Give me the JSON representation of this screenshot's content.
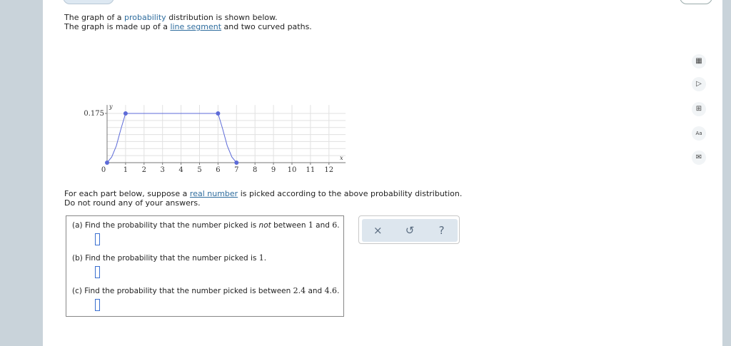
{
  "intro": {
    "line1_pre": "The graph of a ",
    "line1_link": "probability",
    "line1_post": " distribution is shown below.",
    "line2_pre": "The graph is made up of a ",
    "line2_link": "line segment",
    "line2_post": " and two curved paths."
  },
  "chart_data": {
    "type": "line",
    "xlabel": "x",
    "ylabel": "y",
    "xlim": [
      0,
      12.9
    ],
    "ylim": [
      0,
      0.205
    ],
    "x_ticks": [
      "0",
      "1",
      "2",
      "3",
      "4",
      "5",
      "6",
      "7",
      "8",
      "9",
      "10",
      "11",
      "12"
    ],
    "y_ticks": [
      {
        "value": 0.175,
        "label": "0.175"
      }
    ],
    "series": [
      {
        "points": [
          [
            0,
            0
          ],
          [
            0.25,
            0.02
          ],
          [
            0.5,
            0.06
          ],
          [
            0.75,
            0.12
          ],
          [
            1,
            0.175
          ],
          [
            6,
            0.175
          ],
          [
            6.25,
            0.12
          ],
          [
            6.5,
            0.06
          ],
          [
            6.75,
            0.02
          ],
          [
            7,
            0
          ]
        ],
        "markers": [
          [
            0,
            0
          ],
          [
            1,
            0.175
          ],
          [
            6,
            0.175
          ],
          [
            7,
            0
          ]
        ]
      }
    ],
    "colors": {
      "line": "#5d6bd8",
      "grid": "#e1e1e1",
      "axis": "#777777"
    }
  },
  "parts_intro": {
    "line1_pre": "For each part below, suppose a ",
    "line1_link": "real number",
    "line1_post": " is picked according to the above probability distribution.",
    "line2": "Do not round any of your answers."
  },
  "questions": {
    "a": {
      "pre": "(a) Find the probability that the number picked is ",
      "em": "not",
      "mid": " between ",
      "n1": "1",
      "and": " and ",
      "n2": "6",
      "end": "."
    },
    "b": {
      "pre": "(b) Find the probability that the number picked is ",
      "n1": "1",
      "end": "."
    },
    "c": {
      "pre": "(c) Find the probability that the number picked is between ",
      "n1": "2.4",
      "and": " and ",
      "n2": "4.6",
      "end": "."
    }
  },
  "toolbar": {
    "clear": "×",
    "undo": "↺",
    "help": "?"
  },
  "side_icons": [
    "calculator-icon",
    "video-icon",
    "table-icon",
    "textbook-icon",
    "email-icon"
  ],
  "side_glyphs": [
    "▦",
    "▷",
    "⊞",
    "Aa",
    "✉"
  ]
}
